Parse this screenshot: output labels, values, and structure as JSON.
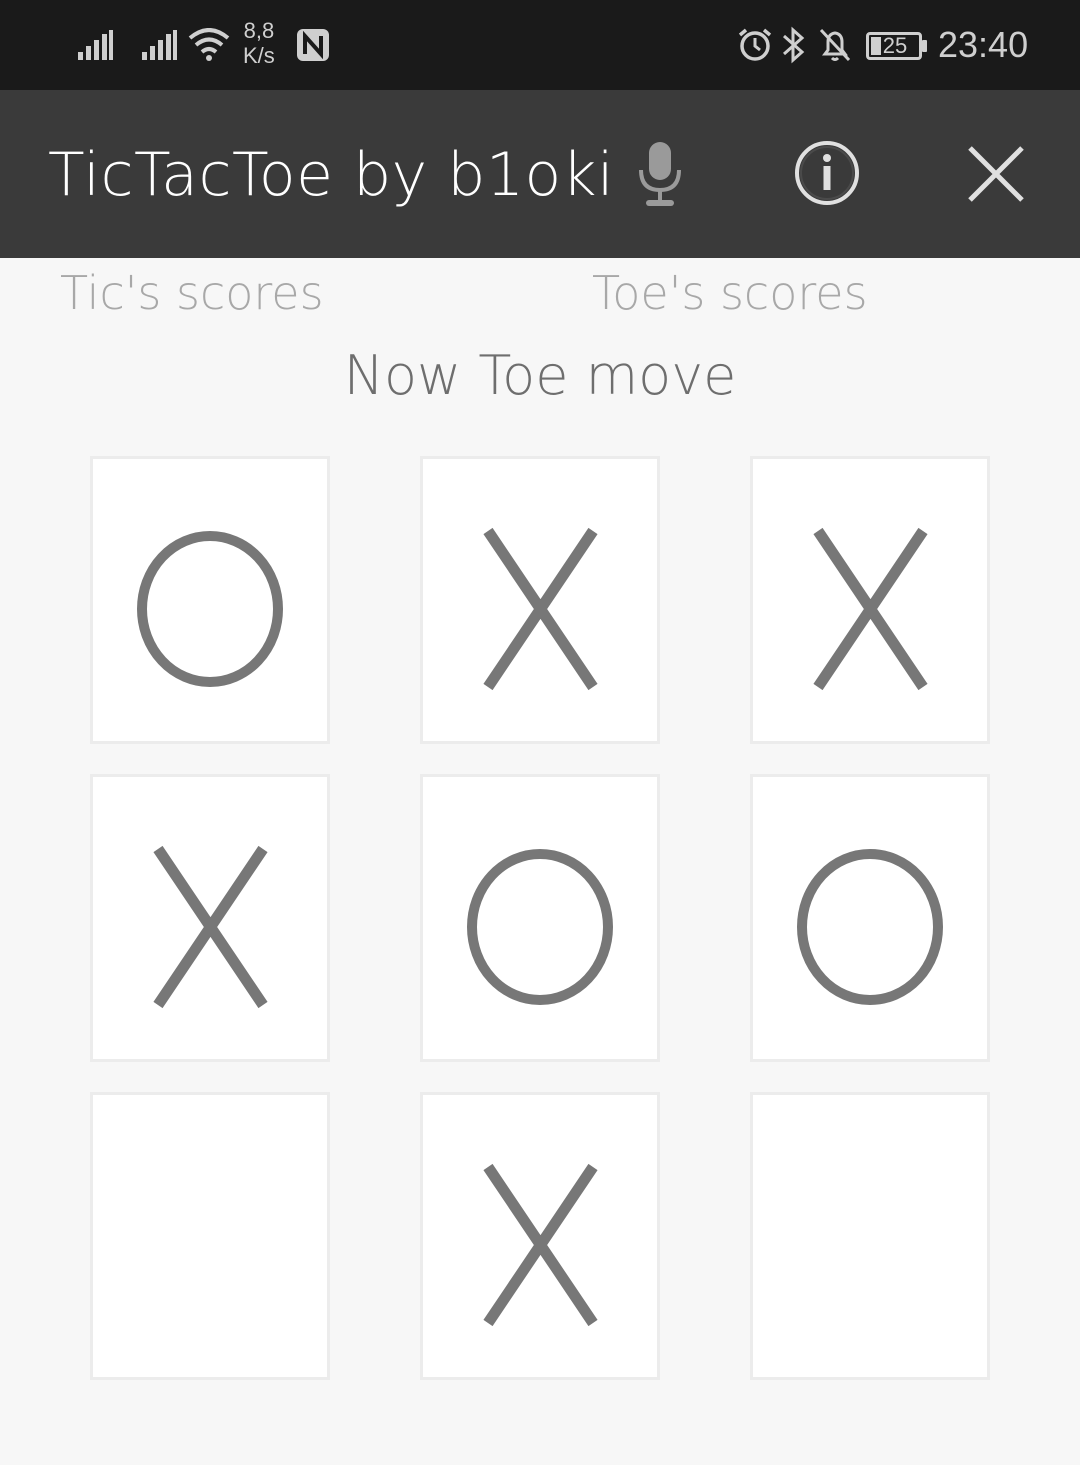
{
  "status_bar": {
    "net_speed_value": "8,8",
    "net_speed_unit": "K/s",
    "battery": "25",
    "time": "23:40",
    "icons": [
      "signal-icon",
      "signal-icon",
      "wifi-icon",
      "nfc-icon",
      "alarm-icon",
      "bluetooth-icon",
      "bell-off-icon",
      "battery-icon"
    ]
  },
  "app_bar": {
    "title": "TicTacToe by b1oki",
    "actions": [
      "mic-icon",
      "info-icon",
      "close-icon"
    ]
  },
  "scores": {
    "tic_label": "Tic's scores",
    "toe_label": "Toe's scores"
  },
  "turn_text": "Now Toe move",
  "board": {
    "cells": [
      "O",
      "X",
      "X",
      "X",
      "O",
      "O",
      "",
      "X",
      ""
    ]
  },
  "colors": {
    "status_bar": "#1a1a1a",
    "app_bar": "#3a3a3a",
    "background": "#f7f7f7",
    "mark": "#777777"
  }
}
